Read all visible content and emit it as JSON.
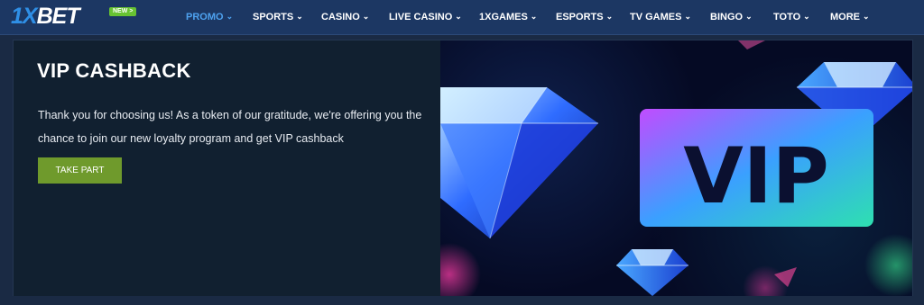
{
  "brand": {
    "logo_text": "1XBET",
    "logo_prefix": "1X",
    "logo_suffix": "BET",
    "new_badge": "NEW >"
  },
  "nav": [
    {
      "label": "PROMO",
      "active": true
    },
    {
      "label": "SPORTS"
    },
    {
      "label": "CASINO"
    },
    {
      "label": "LIVE CASINO"
    },
    {
      "label": "1XGAMES"
    },
    {
      "label": "ESPORTS"
    },
    {
      "label": "TV GAMES"
    },
    {
      "label": "BINGO"
    },
    {
      "label": "TOTO"
    },
    {
      "label": "MORE"
    }
  ],
  "promo": {
    "title": "VIP CASHBACK",
    "description": "Thank you for choosing us! As a token of our gratitude, we're offering you the chance to join our new loyalty program and get VIP cashback",
    "cta": "TAKE PART",
    "banner_text": "VIP"
  },
  "colors": {
    "header_bg": "#1c3763",
    "accent_blue": "#4ea2ef",
    "cta_green": "#6f9a2c",
    "badge_green": "#67c232"
  },
  "icons": {
    "chevron": "chevron-down-icon"
  }
}
